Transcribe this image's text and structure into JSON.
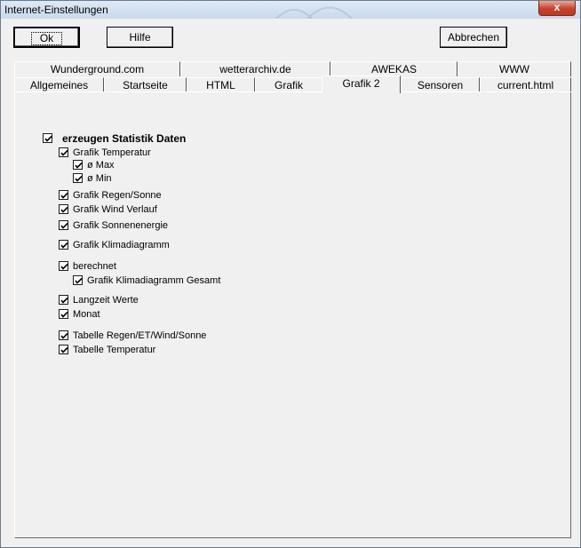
{
  "window": {
    "title": "Internet-Einstellungen",
    "close_glyph": "x"
  },
  "buttons": {
    "ok": "Ok",
    "help": "Hilfe",
    "cancel": "Abbrechen"
  },
  "tabs_back_row": [
    "Wunderground.com",
    "wetterarchiv.de",
    "AWEKAS",
    "WWW"
  ],
  "tabs_front_row": [
    "Allgemeines",
    "Startseite",
    "HTML",
    "Grafik",
    "Grafik 2",
    "Sensoren",
    "current.html"
  ],
  "active_tab": "Grafik 2",
  "options": {
    "master": {
      "label": "erzeugen Statistik Daten",
      "checked": true
    },
    "grafik_temperatur": {
      "label": "Grafik Temperatur",
      "checked": true
    },
    "max": {
      "label": "ø Max",
      "checked": true
    },
    "min": {
      "label": "ø Min",
      "checked": true
    },
    "regen_sonne": {
      "label": "Grafik Regen/Sonne",
      "checked": true
    },
    "wind_verlauf": {
      "label": "Grafik Wind Verlauf",
      "checked": true
    },
    "sonnenenergie": {
      "label": "Grafik Sonnenenergie",
      "checked": true
    },
    "klimadiagramm": {
      "label": "Grafik Klimadiagramm",
      "checked": true
    },
    "berechnet": {
      "label": "berechnet",
      "checked": true
    },
    "klimadiagramm_gesamt": {
      "label": "Grafik Klimadiagramm Gesamt",
      "checked": true
    },
    "langzeit": {
      "label": "Langzeit Werte",
      "checked": true
    },
    "monat": {
      "label": "Monat",
      "checked": true
    },
    "tabelle_regen": {
      "label": "Tabelle Regen/ET/Wind/Sonne",
      "checked": true
    },
    "tabelle_temperatur": {
      "label": "Tabelle Temperatur",
      "checked": true
    }
  }
}
